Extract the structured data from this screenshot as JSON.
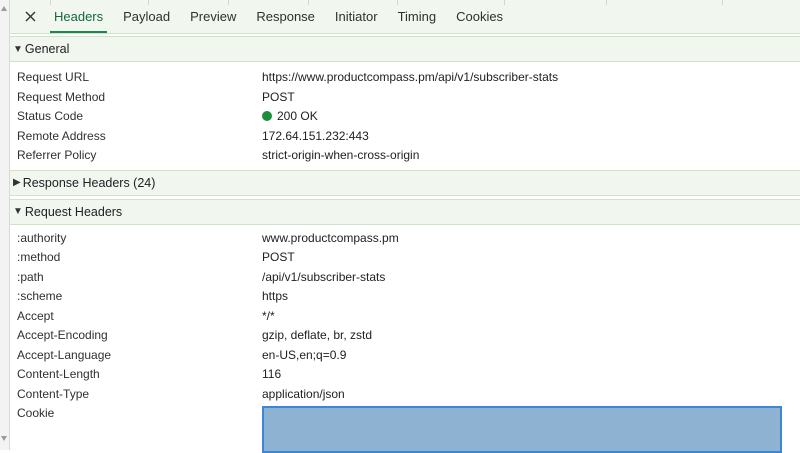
{
  "tabs": [
    {
      "label": "Headers",
      "active": true
    },
    {
      "label": "Payload"
    },
    {
      "label": "Preview"
    },
    {
      "label": "Response"
    },
    {
      "label": "Initiator"
    },
    {
      "label": "Timing"
    },
    {
      "label": "Cookies"
    }
  ],
  "general": {
    "title": "General",
    "rows": [
      {
        "key": "Request URL",
        "value": "https://www.productcompass.pm/api/v1/subscriber-stats"
      },
      {
        "key": "Request Method",
        "value": "POST"
      },
      {
        "key": "Status Code",
        "value": "200 OK",
        "status_color": "#1e8e3e"
      },
      {
        "key": "Remote Address",
        "value": "172.64.151.232:443"
      },
      {
        "key": "Referrer Policy",
        "value": "strict-origin-when-cross-origin"
      }
    ]
  },
  "response_headers": {
    "title": "Response Headers (24)",
    "expanded": false
  },
  "request_headers": {
    "title": "Request Headers",
    "rows": [
      {
        "key": ":authority",
        "value": "www.productcompass.pm"
      },
      {
        "key": ":method",
        "value": "POST"
      },
      {
        "key": ":path",
        "value": "/api/v1/subscriber-stats"
      },
      {
        "key": ":scheme",
        "value": "https"
      },
      {
        "key": "Accept",
        "value": "*/*"
      },
      {
        "key": "Accept-Encoding",
        "value": "gzip, deflate, br, zstd"
      },
      {
        "key": "Accept-Language",
        "value": "en-US,en;q=0.9"
      },
      {
        "key": "Content-Length",
        "value": "116"
      },
      {
        "key": "Content-Type",
        "value": "application/json"
      },
      {
        "key": "Cookie",
        "value": "",
        "redacted": true
      }
    ]
  },
  "colors": {
    "accent": "#1a8a4c",
    "header_bg": "#f1f6ef",
    "redaction": "#8eb2d1"
  }
}
